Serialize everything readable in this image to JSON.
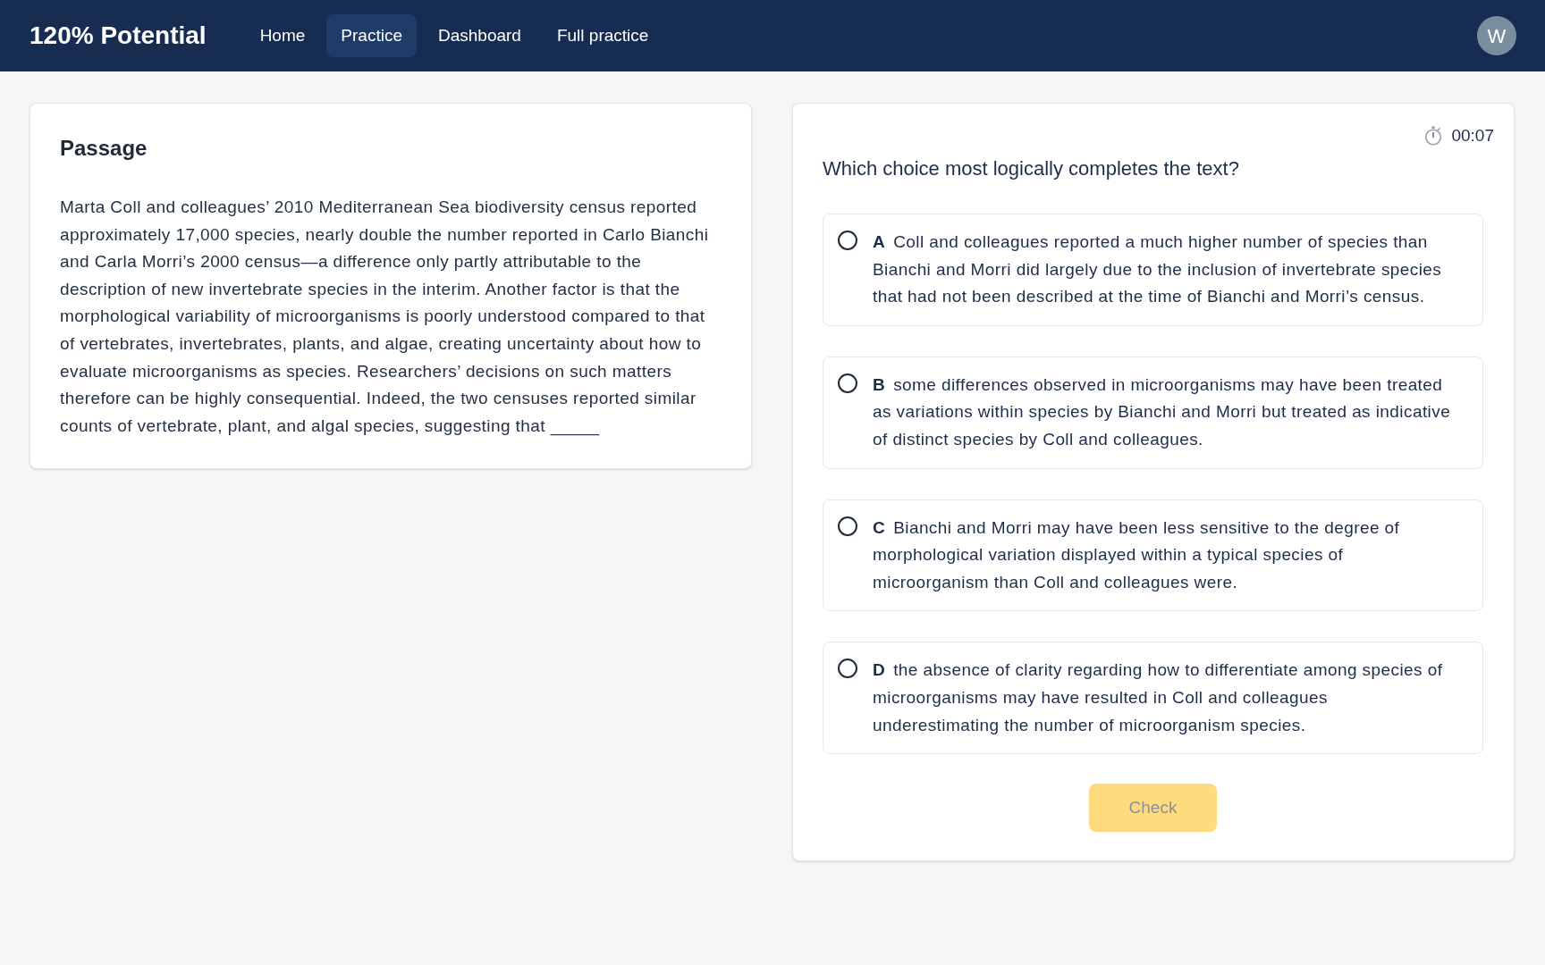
{
  "header": {
    "logo": "120% Potential",
    "nav": [
      {
        "label": "Home",
        "selected": false
      },
      {
        "label": "Practice",
        "selected": true
      },
      {
        "label": "Dashboard",
        "selected": false
      },
      {
        "label": "Full practice",
        "selected": false
      }
    ],
    "avatar": "W"
  },
  "passage": {
    "title": "Passage",
    "text": "Marta Coll and colleagues’ 2010 Mediterranean Sea biodiversity census reported approximately 17,000 species, nearly double the number reported in Carlo Bianchi and Carla Morri’s 2000 census—a difference only partly attributable to the description of new invertebrate species in the interim. Another factor is that the morphological variability of microorganisms is poorly understood compared to that of vertebrates, invertebrates, plants, and algae, creating uncertainty about how to evaluate microorganisms as species. Researchers’ decisions on such matters therefore can be highly consequential. Indeed, the two censuses reported similar counts of vertebrate, plant, and algal species, suggesting that _____"
  },
  "question": {
    "timer": "00:07",
    "prompt": "Which choice most logically completes the text?",
    "options": [
      {
        "letter": "A",
        "text": "Coll and colleagues reported a much higher number of species than Bianchi and Morri did largely due to the inclusion of invertebrate species that had not been described at the time of Bianchi and Morri’s census.",
        "selected": false
      },
      {
        "letter": "B",
        "text": "some differences observed in microorganisms may have been treated as variations within species by Bianchi and Morri but treated as indicative of distinct species by Coll and colleagues.",
        "selected": false
      },
      {
        "letter": "C",
        "text": "Bianchi and Morri may have been less sensitive to the degree of morphological variation displayed within a typical species of microorganism than Coll and colleagues were.",
        "selected": false
      },
      {
        "letter": "D",
        "text": "the absence of clarity regarding how to differentiate among species of microorganisms may have resulted in Coll and colleagues underestimating the number of microorganism species.",
        "selected": false
      }
    ],
    "check_button": {
      "label": "Check",
      "disabled": true
    }
  }
}
